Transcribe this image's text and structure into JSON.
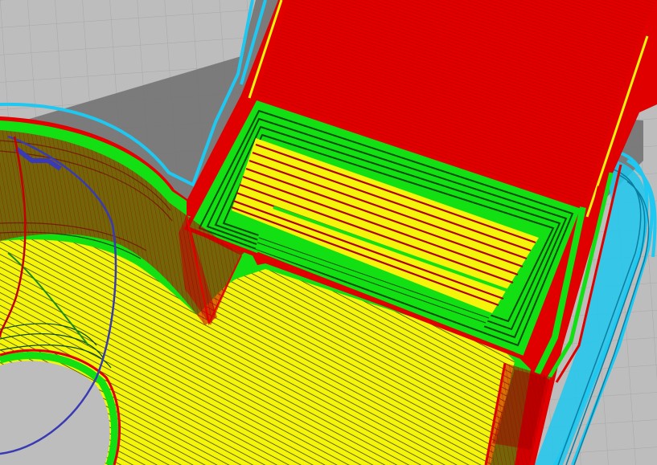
{
  "app": {
    "view": "layer-preview-3d"
  },
  "colors": {
    "build_plate": "#bdbdbd",
    "grid_line": "#a9a9a9",
    "shadow": "#6f6f6f",
    "skirt": "#1ec8f0",
    "outer_wall": "#e60000",
    "inner_wall": "#12e012",
    "infill": "#f2f20a",
    "support_travel": "#3a3ab4",
    "dark_wall": "#7a0000"
  },
  "legend_items": [
    {
      "icon": "outer-wall-icon",
      "color_key": "outer_wall"
    },
    {
      "icon": "inner-wall-icon",
      "color_key": "inner_wall"
    },
    {
      "icon": "infill-icon",
      "color_key": "infill"
    },
    {
      "icon": "skirt-icon",
      "color_key": "skirt"
    },
    {
      "icon": "travel-move-icon",
      "color_key": "support_travel"
    }
  ]
}
